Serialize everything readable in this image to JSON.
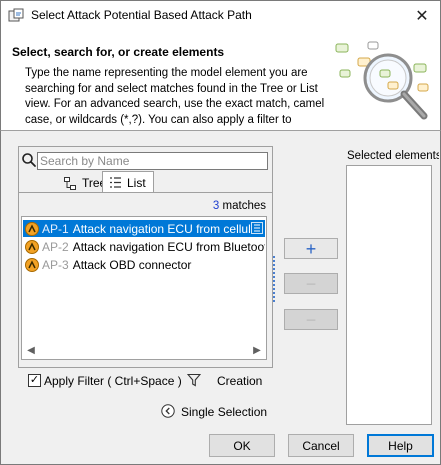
{
  "window": {
    "title": "Select Attack Potential Based Attack Path",
    "close_glyph": "✕"
  },
  "header": {
    "title": "Select, search for, or create elements",
    "description": "Type the name representing the model element you are searching for and select matches found in the Tree or List view. For an advanced search, use the exact match, camel case, or wildcards (*,?). You can also apply a filter to"
  },
  "search": {
    "placeholder": "Search by Name",
    "value": ""
  },
  "tabs": [
    {
      "label": "Tree",
      "icon": "tree-icon",
      "active": false
    },
    {
      "label": "List",
      "icon": "list-icon",
      "active": true
    }
  ],
  "results": {
    "count": "3",
    "count_suffix": "matches",
    "items": [
      {
        "id": "AP-1",
        "name": "Attack navigation ECU from cellular",
        "selected": true,
        "icon": "attack-path-icon"
      },
      {
        "id": "AP-2",
        "name": "Attack navigation ECU from Bluetooth",
        "selected": false,
        "icon": "attack-path-icon"
      },
      {
        "id": "AP-3",
        "name": "Attack OBD connector",
        "selected": false,
        "icon": "attack-path-icon"
      }
    ]
  },
  "transfer": {
    "add_glyph": "+",
    "remove_glyph": "−",
    "remove_all_glyph": "−"
  },
  "selected_panel": {
    "label": "Selected elements"
  },
  "filter": {
    "apply_label": "Apply Filter ( Ctrl+Space )",
    "apply_checked": true,
    "creation_label": "Creation"
  },
  "selection_mode": {
    "label": "Single Selection"
  },
  "buttons": {
    "ok": "OK",
    "cancel": "Cancel",
    "help": "Help"
  },
  "colors": {
    "accent": "#0078d7",
    "match_count": "#1f3fd0",
    "add_plus": "#2a64c5"
  }
}
